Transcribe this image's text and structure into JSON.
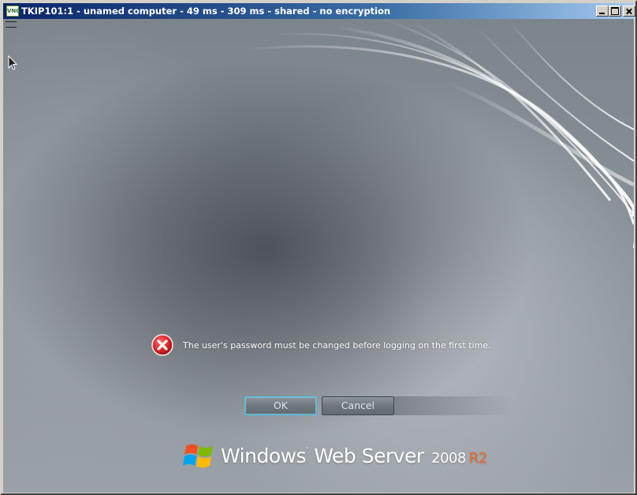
{
  "window": {
    "title": "TKIP101:1 - unamed computer - 49 ms - 309 ms - shared - no encryption",
    "app_icon_text": "VNC",
    "controls": [
      "minimize-icon",
      "maximize-icon",
      "close-icon"
    ]
  },
  "login_screen": {
    "error_message": "The user's password must be changed before logging on the first time.",
    "error_icon": "error-x-icon",
    "ok_label": "OK",
    "cancel_label": "Cancel"
  },
  "branding": {
    "product": "Windows",
    "edition": "Web Server",
    "version": "2008",
    "release": "R2",
    "accent_color": "#f26522"
  },
  "colors": {
    "titlebar_start": "#0a246a",
    "titlebar_end": "#a6caf0",
    "ok_focus_border": "#3ec4e8",
    "error_red": "#d8232a"
  }
}
